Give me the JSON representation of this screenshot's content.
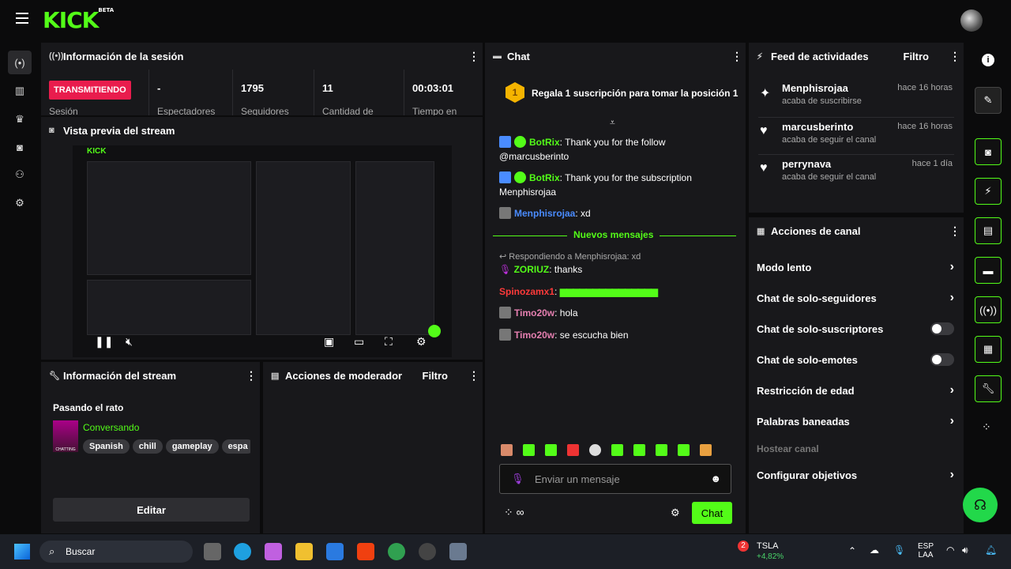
{
  "brand": {
    "logo": "KICK",
    "beta": "BETA"
  },
  "session": {
    "title": "Información de la sesión",
    "status": "TRANSMITIENDO",
    "stats": [
      {
        "value": "-",
        "label": "Espectadores"
      },
      {
        "value": "1795",
        "label": "Seguidores"
      },
      {
        "value": "11",
        "label": "Cantidad de"
      },
      {
        "value": "00:03:01",
        "label": "Tiempo en"
      }
    ],
    "extra_label": "Sesión"
  },
  "preview": {
    "title": "Vista previa del stream"
  },
  "stream_info": {
    "title": "Información del stream",
    "stream_title": "Pasando el rato",
    "category": "Conversando",
    "tags": [
      "Spanish",
      "chill",
      "gameplay",
      "espa"
    ],
    "edit_label": "Editar",
    "thumb_text": "CHATTING"
  },
  "mod_actions": {
    "title": "Acciones de moderador",
    "filter": "Filtro"
  },
  "chat": {
    "title": "Chat",
    "pinned": "Regala 1 suscripción para tomar la posición 1",
    "pinned_rank": "1",
    "messages": [
      {
        "user": "BotRix",
        "text": ": Thank you for the follow @marcusberinto"
      },
      {
        "user": "BotRix",
        "text": ": Thank you for the subscription Menphisrojaa"
      },
      {
        "user": "Menphisrojaa",
        "text": ": xd"
      }
    ],
    "new_messages": "Nuevos mensajes",
    "reply_to": "Respondiendo a Menphisrojaa: xd",
    "later": [
      {
        "user": "ZORIUZ",
        "text": ": thanks"
      },
      {
        "user": "Spinozamx1",
        "text": ":"
      },
      {
        "user": "Timo20w",
        "text": ": hola"
      },
      {
        "user": "Timo20w",
        "text": ": se escucha bien"
      }
    ],
    "placeholder": "Enviar un mensaje",
    "send_label": "Chat"
  },
  "feed": {
    "title": "Feed de actividades",
    "filter": "Filtro",
    "items": [
      {
        "name": "Menphisrojaa",
        "sub": "acaba de suscribirse",
        "time": "hace 16 horas"
      },
      {
        "name": "marcusberinto",
        "sub": "acaba de seguir el canal",
        "time": "hace 16 horas"
      },
      {
        "name": "perrynava",
        "sub": "acaba de seguir el canal",
        "time": "hace 1 día"
      }
    ]
  },
  "channel_actions": {
    "title": "Acciones de canal",
    "items": [
      "Modo lento",
      "Chat de solo-seguidores",
      "Chat de solo-suscriptores",
      "Chat de solo-emotes",
      "Restricción de edad",
      "Palabras baneadas",
      "Hostear canal",
      "Configurar objetivos"
    ]
  },
  "taskbar": {
    "search": "Buscar",
    "stock_name": "TSLA",
    "stock_change": "+4,82%",
    "stock_badge": "2",
    "lang_top": "ESP",
    "lang_bottom": "LAA"
  },
  "colors": {
    "accent": "#53fc18",
    "live": "#e91c4d",
    "panel": "#18181b",
    "bg": "#0b0b0c"
  }
}
